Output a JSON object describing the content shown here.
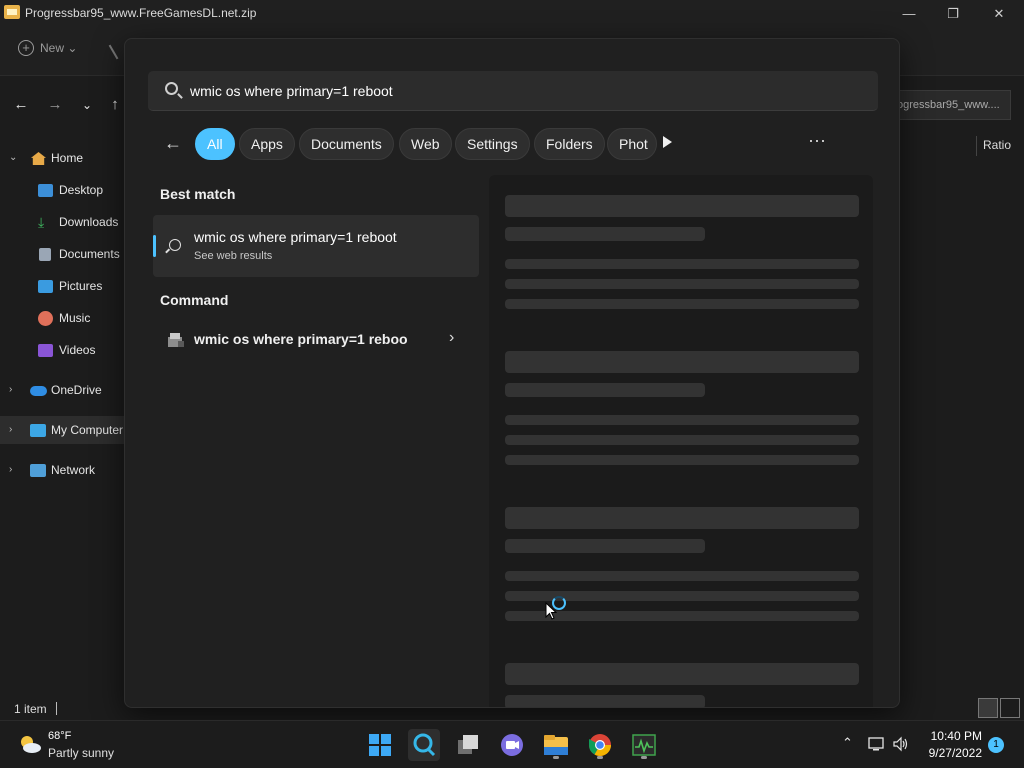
{
  "explorer": {
    "title": "Progressbar95_www.FreeGamesDL.net.zip",
    "toolbar": {
      "new_label": "New"
    },
    "address": "ogressbar95_www....",
    "column_ratio": "Ratio",
    "sidebar": [
      {
        "label": "Home",
        "icon": "home-icon",
        "expand": true
      },
      {
        "label": "Desktop",
        "icon": "desktop-icon"
      },
      {
        "label": "Downloads",
        "icon": "downloads-icon"
      },
      {
        "label": "Documents",
        "icon": "documents-icon"
      },
      {
        "label": "Pictures",
        "icon": "pictures-icon"
      },
      {
        "label": "Music",
        "icon": "music-icon"
      },
      {
        "label": "Videos",
        "icon": "videos-icon"
      },
      {
        "label": "OneDrive",
        "icon": "onedrive-icon"
      },
      {
        "label": "My Computer",
        "icon": "computer-icon"
      },
      {
        "label": "Network",
        "icon": "network-icon"
      }
    ],
    "status": {
      "count": "1 item"
    }
  },
  "search": {
    "query": "wmic os where primary=1 reboot",
    "filters": [
      "All",
      "Apps",
      "Documents",
      "Web",
      "Settings",
      "Folders",
      "Phot"
    ],
    "active_filter": "All",
    "best_match_heading": "Best match",
    "best_match": {
      "title": "wmic os where primary=1 reboot",
      "subtitle": "See web results"
    },
    "command_heading": "Command",
    "command": {
      "label": "wmic os where primary=1 reboo"
    }
  },
  "taskbar": {
    "weather": {
      "temp": "68°F",
      "desc": "Partly sunny"
    },
    "apps": [
      "start-icon",
      "search-icon",
      "task-view-icon",
      "chat-icon",
      "file-explorer-icon",
      "chrome-icon",
      "task-manager-icon"
    ],
    "time": "10:40 PM",
    "date": "9/27/2022",
    "notifications": "1"
  },
  "colors": {
    "accent": "#4cc2ff",
    "panel": "#202020",
    "skeleton": "#333333"
  }
}
